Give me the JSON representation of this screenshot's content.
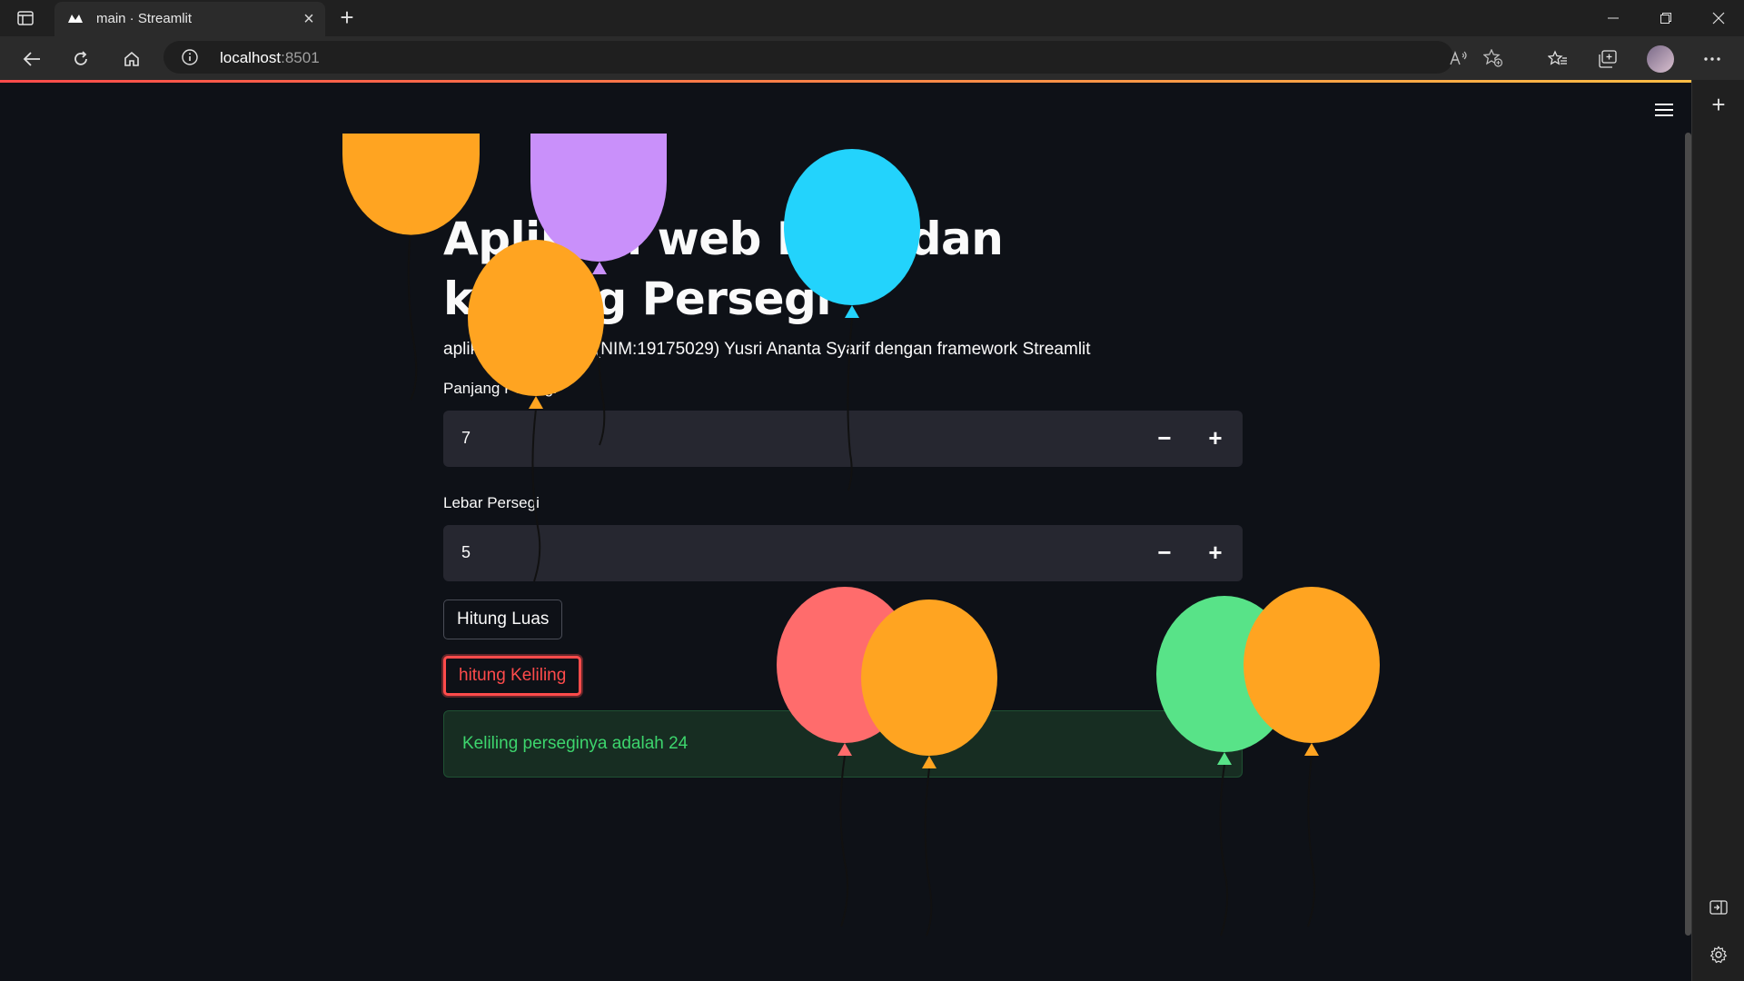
{
  "browser": {
    "tab_title": "main · Streamlit",
    "url_host": "localhost",
    "url_port": ":8501"
  },
  "app": {
    "title": "Aplikasi web Luas dan keliling Persegi",
    "subtitle": "aplikasi dibuat oleh (NIM:19175029) Yusri Ananta Syarif dengan framework Streamlit",
    "inputs": [
      {
        "label": "Panjang Persegi",
        "value": "7"
      },
      {
        "label": "Lebar Persegi",
        "value": "5"
      }
    ],
    "buttons": {
      "luas": "Hitung Luas",
      "keliling": "hitung Keliling"
    },
    "result": "Keliling perseginya adalah 24",
    "stepper": {
      "minus": "−",
      "plus": "+"
    }
  },
  "colors": {
    "accent": "#ff4b4b",
    "success_text": "#3dd56d",
    "balloon_orange": "#ffa421",
    "balloon_purple": "#c990fa",
    "balloon_cyan": "#23d3fc",
    "balloon_red": "#ff6c6c",
    "balloon_green": "#58e388"
  }
}
